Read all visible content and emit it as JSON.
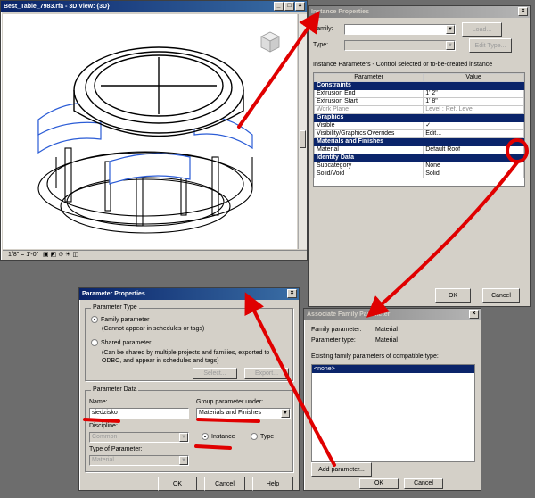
{
  "view3d": {
    "title": "Best_Table_7983.rfa - 3D View: {3D}",
    "scale": "1/8\" = 1'-0\""
  },
  "instance_props": {
    "title": "Instance Properties",
    "family_label": "Family:",
    "type_label": "Type:",
    "load_label": "Load...",
    "edit_type_label": "Edit Type...",
    "instance_params_label": "Instance Parameters - Control selected or to-be-created instance",
    "col_param": "Parameter",
    "col_value": "Value",
    "sections": [
      {
        "name": "Constraints",
        "rows": [
          {
            "param": "Extrusion End",
            "value": "1'  2\""
          },
          {
            "param": "Extrusion Start",
            "value": "1'  8\""
          },
          {
            "param": "Work Plane",
            "value": "Level : Ref. Level"
          }
        ]
      },
      {
        "name": "Graphics",
        "rows": [
          {
            "param": "Visible",
            "value": "✓"
          },
          {
            "param": "Visibility/Graphics Overrides",
            "value": "Edit..."
          }
        ]
      },
      {
        "name": "Materials and Finishes",
        "rows": [
          {
            "param": "Material",
            "value": "Default Roof"
          }
        ]
      },
      {
        "name": "Identity Data",
        "rows": [
          {
            "param": "Subcategory",
            "value": "None"
          },
          {
            "param": "Solid/Void",
            "value": "Solid"
          }
        ]
      }
    ],
    "ok_label": "OK",
    "cancel_label": "Cancel"
  },
  "param_props": {
    "title": "Parameter Properties",
    "param_type_group": "Parameter Type",
    "family_param": "Family parameter",
    "family_param_desc": "(Cannot appear in schedules or tags)",
    "shared_param": "Shared parameter",
    "shared_param_desc": "(Can be shared by multiple projects and families, exported to ODBC, and appear in schedules and tags)",
    "select_label": "Select...",
    "export_label": "Export...",
    "param_data_group": "Parameter Data",
    "name_label": "Name:",
    "name_value": "siedzisko",
    "group_under_label": "Group parameter under:",
    "group_under_value": "Materials and Finishes",
    "discipline_label": "Discipline:",
    "discipline_value": "Common",
    "type_param_label": "Type of Parameter:",
    "type_param_value": "Material",
    "instance_label": "Instance",
    "type_label": "Type",
    "ok_label": "OK",
    "cancel_label": "Cancel",
    "help_label": "Help"
  },
  "assoc": {
    "title": "Associate Family Parameter",
    "family_param_label": "Family parameter:",
    "family_param_value": "Material",
    "param_type_label": "Parameter type:",
    "param_type_value": "Material",
    "existing_label": "Existing family parameters of compatible type:",
    "list_items": [
      "<none>"
    ],
    "add_param_label": "Add parameter...",
    "ok_label": "OK",
    "cancel_label": "Cancel"
  },
  "colors": {
    "annotation_red": "#e00000",
    "title_active": "#0a246a",
    "selection_blue": "#2b5cd6"
  }
}
